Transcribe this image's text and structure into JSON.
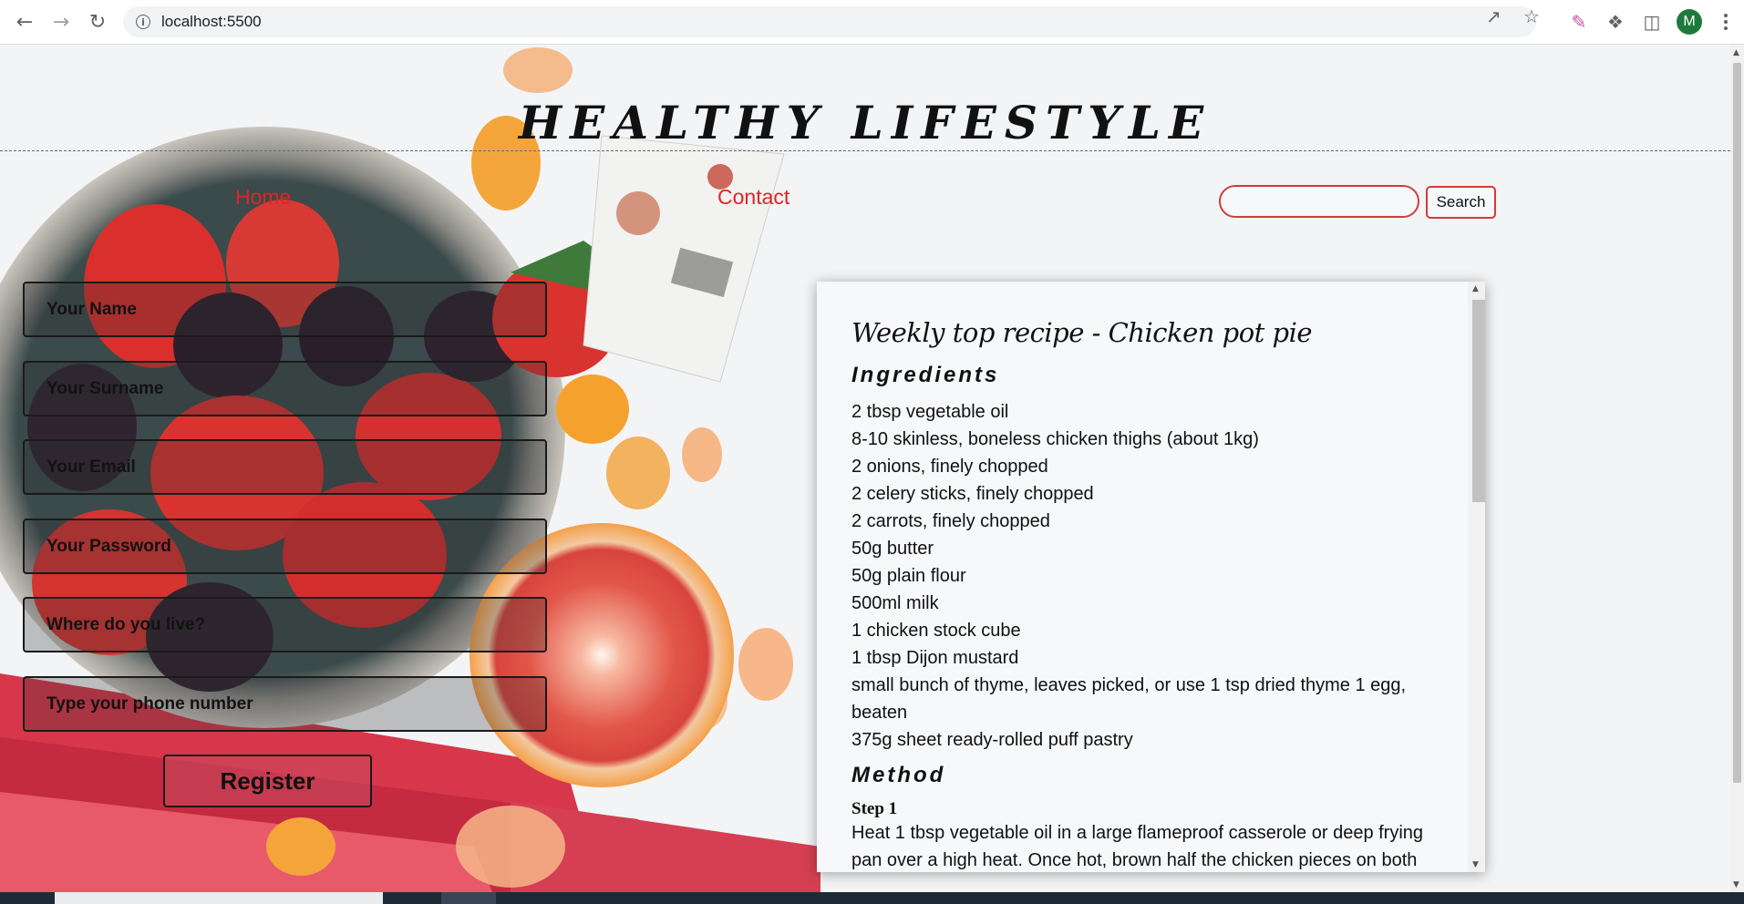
{
  "browser": {
    "url": "localhost:5500",
    "avatar_initial": "M",
    "icons": [
      "back-arrow-icon",
      "forward-arrow-icon",
      "reload-icon",
      "site-info-icon",
      "share-icon",
      "bookmark-star-icon",
      "color-picker-extension-icon",
      "extensions-puzzle-icon",
      "side-panel-icon",
      "menu-kebab-icon"
    ]
  },
  "site": {
    "title": "HEALTHY LIFESTYLE"
  },
  "nav": {
    "home": "Home",
    "contact": "Contact",
    "search_value": "",
    "search_button": "Search",
    "link_color": "#e02424"
  },
  "form": {
    "name_placeholder": "Your Name",
    "surname_placeholder": "Your Surname",
    "email_placeholder": "Your Email",
    "password_placeholder": "Your Password",
    "location_placeholder": "Where do you live?",
    "phone_placeholder": "Type your phone number",
    "register_label": "Register"
  },
  "recipe": {
    "title": "Weekly top recipe - Chicken pot pie",
    "ingredients_heading": "Ingredients",
    "ingredients": [
      "2 tbsp vegetable oil",
      "8-10 skinless, boneless chicken thighs (about 1kg)",
      "2 onions, finely chopped",
      "2 celery sticks, finely chopped",
      "2 carrots, finely chopped",
      "50g butter",
      "50g plain flour",
      "500ml milk",
      "1 chicken stock cube",
      "1 tbsp Dijon mustard",
      "small bunch of thyme, leaves picked, or use 1 tsp dried thyme 1 egg, beaten",
      "375g sheet ready-rolled puff pastry"
    ],
    "method_heading": "Method",
    "steps": [
      {
        "title": "Step 1",
        "text": "Heat 1 tbsp vegetable oil in a large flameproof casserole or deep frying pan over a high heat. Once hot, brown half the chicken pieces on both"
      }
    ]
  }
}
